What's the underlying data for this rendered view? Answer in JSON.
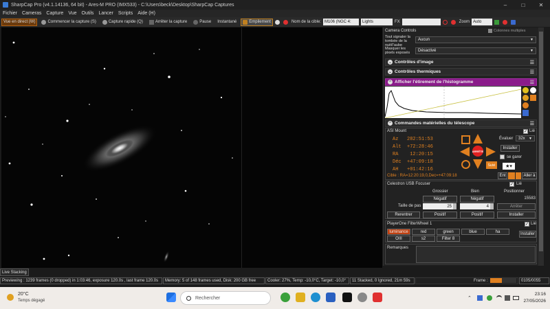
{
  "window": {
    "title": "SharpCap Pro (v4.1.14136, 64 bit) - Ares-M PRO (IMX533) - C:\\Users\\beck\\Desktop\\SharpCap Captures"
  },
  "menu": [
    "Fichier",
    "Cameras",
    "Capture",
    "Vue",
    "Outils",
    "Lancer",
    "Scripts",
    "Aide (H)"
  ],
  "toolbar": {
    "live": "Vue en direct (W)",
    "start_capture": "Commencer la capture (S)",
    "quick_capture": "Capture rapide (Q)",
    "stop_capture": "Arrêter la capture",
    "pause": "Pause",
    "snapshot": "Instantané",
    "stacking": "Empilement",
    "target_label": "Nom de la cible:",
    "target_value": "M106 (NGC 4:",
    "frame_type": "Lights",
    "fx_label": "FX",
    "zoom_label": "Zoom",
    "zoom_value": "Auto"
  },
  "panel": {
    "header_camera": "Camera Controls",
    "multi_columns": "Colonnes multiples",
    "row1_label": "Tout signaler la tombée de la nuit/l’aube",
    "row1_value": "Aucun",
    "row2_label": "Masquer les pixels exposés",
    "row2_value": "Désactivé",
    "image_controls": "Contrôles d'image",
    "thermal_controls": "Contrôles thermiques",
    "histogram": "Afficher l'étirement de l'histogramme",
    "telescope": "Commandes matérielles du télescope",
    "mount": {
      "name": "ASI Mount",
      "linked": "Lié",
      "az": "Az   282:51:53",
      "alt": "Alt  +72:28:46",
      "ra": "RA    12:20:15",
      "dec": "Déc  +47:09:18",
      "ah": "AH   +01:42:16",
      "evaluate_label": "Évaluer",
      "rate": "32x",
      "install": "Installer",
      "park": "se garer",
      "stop": "ARRÊTE",
      "follow": "Suivi",
      "target": "Cible : RA=12:20:19,0,Dec=+47:09:18",
      "ent": "Ent",
      "goto": "Aller à"
    },
    "focuser": {
      "name": "Celestron USB Focuser",
      "linked": "Lié",
      "col_coarse": "Grossier",
      "col_fine": "Bien",
      "col_position": "Positionner",
      "neg": "Négatif",
      "position_value": "15583",
      "step_label": "Taille de pas",
      "coarse_step": "25",
      "fine_step": "4",
      "stop": "Arrêter",
      "retract": "Rerentrer",
      "positive": "Positif",
      "install": "Installer"
    },
    "filterwheel": {
      "name": "PlayerOne FilterWheel 1",
      "linked": "Lié",
      "filters_row1": [
        "luminance",
        "red",
        "green",
        "blue",
        "ha"
      ],
      "filters_row2": [
        "OIII",
        "s2",
        "Filter 8"
      ],
      "install": "Installer"
    },
    "remarks": "Remarques"
  },
  "live_stacking": "Live Stacking",
  "status": {
    "preview": "Previewing : 1239 frames (0 dropped) in 1:03:46, exposure 120.0s , last frame 120.0s",
    "memory": "Memory: 5 of 148 frames used, Disk: 200 GB free",
    "cooler": "Cooler: 27%, Temp: -10,0°C, Target: -10,0°",
    "stacked": "11 Stacked, 0 Ignored, 21m 59s",
    "frame_label": "Frame :",
    "frame_counter": "0105/0055",
    "frame_progress": 0.45
  },
  "taskbar": {
    "weather_temp": "20°C",
    "weather_desc": "Temps dégagé",
    "search": "Rechercher",
    "time": "23:16",
    "date": "27/05/2026"
  },
  "colors": {
    "accent_orange": "#e08020",
    "histogram_header": "#8a1b8a",
    "stop_red": "#e02020"
  }
}
